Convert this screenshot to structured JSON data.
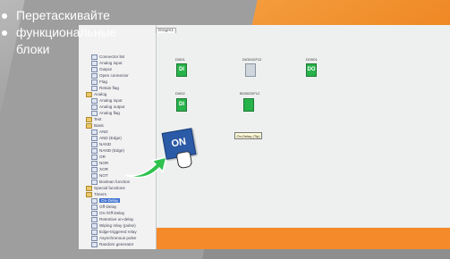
{
  "caption": [
    "Перетаскивайте",
    "функциональные",
    "блоки"
  ],
  "tab": "Dragm1",
  "tree": [
    {
      "label": "Connector list",
      "type": "i"
    },
    {
      "label": "Analog input",
      "type": "i"
    },
    {
      "label": "Output",
      "type": "i"
    },
    {
      "label": "Open connector",
      "type": "i"
    },
    {
      "label": "Flag",
      "type": "i"
    },
    {
      "label": "Retain flag",
      "type": "i"
    },
    {
      "label": "Analog",
      "type": "f"
    },
    {
      "label": "Analog input",
      "type": "i"
    },
    {
      "label": "Analog output",
      "type": "i"
    },
    {
      "label": "Analog flag",
      "type": "i"
    },
    {
      "label": "Test",
      "type": "f"
    },
    {
      "label": "Basic",
      "type": "f"
    },
    {
      "label": "AND",
      "type": "i"
    },
    {
      "label": "AND (Edge)",
      "type": "i"
    },
    {
      "label": "NAND",
      "type": "i"
    },
    {
      "label": "NAND (Edge)",
      "type": "i"
    },
    {
      "label": "OR",
      "type": "i"
    },
    {
      "label": "NOR",
      "type": "i"
    },
    {
      "label": "XOR",
      "type": "i"
    },
    {
      "label": "NOT",
      "type": "i"
    },
    {
      "label": "Boolean function",
      "type": "i"
    },
    {
      "label": "Special functions",
      "type": "f"
    },
    {
      "label": "Timers",
      "type": "f"
    },
    {
      "label": "On-Delay",
      "type": "sel"
    },
    {
      "label": "Off-Delay",
      "type": "i"
    },
    {
      "label": "On-/Off-Delay",
      "type": "i"
    },
    {
      "label": "Retentive on-delay",
      "type": "i"
    },
    {
      "label": "Wiping relay (pulse)",
      "type": "i"
    },
    {
      "label": "Edge-triggered relay",
      "type": "i"
    },
    {
      "label": "Asynchronous pulse",
      "type": "i"
    },
    {
      "label": "Random generator",
      "type": "i"
    }
  ],
  "blocks": [
    {
      "name": "DI001",
      "text": "DI",
      "style": "green"
    },
    {
      "name": "DIO01DF12",
      "text": "",
      "style": "grey"
    },
    {
      "name": "DO001",
      "text": "DO",
      "style": "green"
    },
    {
      "name": "DI002",
      "text": "DI",
      "style": "green"
    },
    {
      "name": "BO002DF12",
      "text": "",
      "style": "green"
    }
  ],
  "tooltip": "On-Delay (Tip)",
  "drag_block": "ON",
  "colors": {
    "accent": "#ef8a26",
    "block_green": "#27b24a",
    "drag_blue": "#2b5aa6"
  }
}
